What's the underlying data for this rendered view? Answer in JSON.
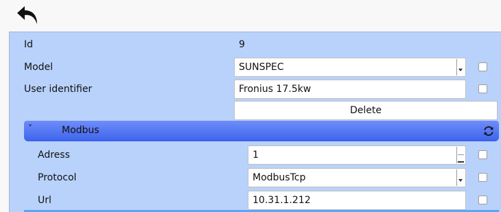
{
  "toolbar": {
    "back_icon": "undo-arrow-icon"
  },
  "fields": {
    "id": {
      "label": "Id",
      "value": "9"
    },
    "model": {
      "label": "Model",
      "value": "SUNSPEC"
    },
    "user_identifier": {
      "label": "User identifier",
      "value": "Fronius 17.5kw"
    },
    "delete_label": "Delete"
  },
  "modbus": {
    "title": "Modbus",
    "chevron": "˅",
    "refresh_icon": "refresh-icon",
    "adress": {
      "label": "Adress",
      "value": "1"
    },
    "protocol": {
      "label": "Protocol",
      "value": "ModbusTcp"
    },
    "url": {
      "label": "Url",
      "value": "10.31.1.212"
    }
  },
  "colors": {
    "panel": "#b8d2fb",
    "section_header_top": "#6f8df9",
    "section_header_bottom": "#3c63ec",
    "background": "#f8f8f8"
  }
}
